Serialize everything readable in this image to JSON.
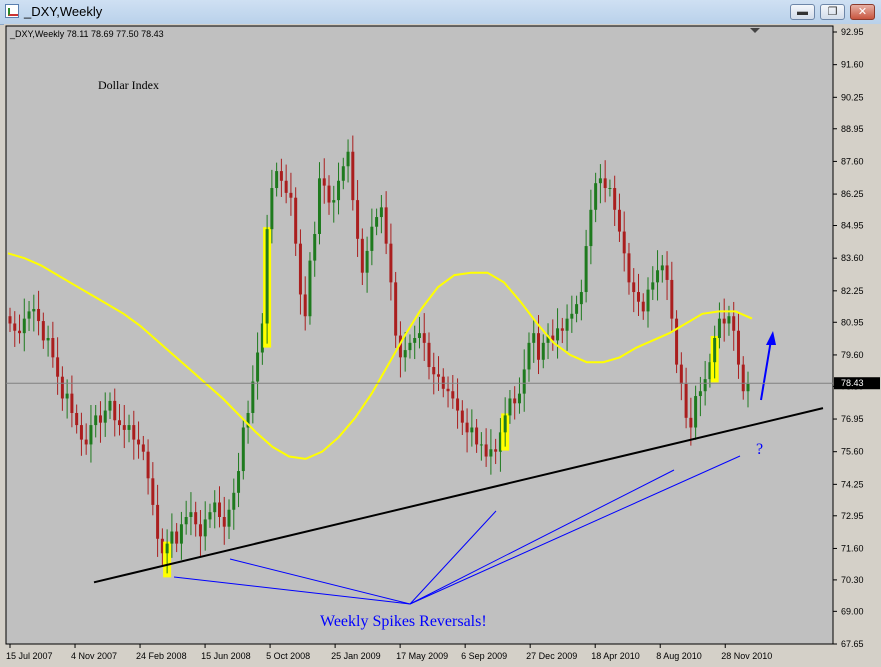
{
  "window": {
    "title": "_DXY,Weekly",
    "buttons": {
      "minimize": "▬",
      "restore": "❐",
      "close": "✕"
    }
  },
  "chart_header": {
    "symbol_line": "_DXY,Weekly  78.11 78.69 77.50 78.43",
    "title": "Dollar Index"
  },
  "chart_data": {
    "type": "candlestick",
    "symbol": "_DXY",
    "timeframe": "Weekly",
    "ohlc_last": {
      "open": 78.11,
      "high": 78.69,
      "low": 77.5,
      "close": 78.43
    },
    "current_price_label": "78.43",
    "ylim": [
      67.65,
      92.95
    ],
    "y_ticks": [
      "92.95",
      "91.60",
      "90.25",
      "88.95",
      "87.60",
      "86.25",
      "84.95",
      "83.60",
      "82.25",
      "80.95",
      "79.60",
      "78.30",
      "76.95",
      "75.60",
      "74.25",
      "72.95",
      "71.60",
      "70.30",
      "69.00",
      "67.65"
    ],
    "x_ticks": [
      "15 Jul 2007",
      "4 Nov 2007",
      "24 Feb 2008",
      "15 Jun 2008",
      "5 Oct 2008",
      "25 Jan 2009",
      "17 May 2009",
      "6 Sep 2009",
      "27 Dec 2009",
      "18 Apr 2010",
      "8 Aug 2010",
      "28 Nov 2010"
    ],
    "closes": [
      80.9,
      80.6,
      80.5,
      81.1,
      81.4,
      81.5,
      81.0,
      80.2,
      80.3,
      79.5,
      78.7,
      77.8,
      78.0,
      77.2,
      76.7,
      76.1,
      75.9,
      76.7,
      77.1,
      76.8,
      77.3,
      77.7,
      76.9,
      76.7,
      76.5,
      76.7,
      76.1,
      75.9,
      75.6,
      74.5,
      73.4,
      72.0,
      71.4,
      71.8,
      72.3,
      71.8,
      72.6,
      72.9,
      73.1,
      72.6,
      72.1,
      72.8,
      73.1,
      73.5,
      72.9,
      72.5,
      73.2,
      73.9,
      74.8,
      76.6,
      77.2,
      78.5,
      79.7,
      80.9,
      84.8,
      86.5,
      87.2,
      86.8,
      86.3,
      86.1,
      84.2,
      82.1,
      81.2,
      83.5,
      84.6,
      86.9,
      86.6,
      85.9,
      86.0,
      86.8,
      87.4,
      88.0,
      86.0,
      84.4,
      83.0,
      83.9,
      84.9,
      85.3,
      85.7,
      84.2,
      82.6,
      80.4,
      79.5,
      79.8,
      80.1,
      80.3,
      80.5,
      80.1,
      79.1,
      78.8,
      78.7,
      78.2,
      78.1,
      77.8,
      77.3,
      76.8,
      76.4,
      76.6,
      75.9,
      75.9,
      75.4,
      75.7,
      75.6,
      76.4,
      77.1,
      77.8,
      77.6,
      78.0,
      79.0,
      80.1,
      80.5,
      79.4,
      80.1,
      80.4,
      80.2,
      80.7,
      80.6,
      81.1,
      81.3,
      81.7,
      82.2,
      84.1,
      85.6,
      86.7,
      86.9,
      86.5,
      86.5,
      85.6,
      84.7,
      83.8,
      82.6,
      82.2,
      81.8,
      81.4,
      82.3,
      82.6,
      83.1,
      83.3,
      82.7,
      81.1,
      79.2,
      78.4,
      77.0,
      76.6,
      77.9,
      78.1,
      78.6,
      79.3,
      80.3,
      81.1,
      80.9,
      81.2,
      80.6,
      79.2,
      78.1,
      78.4
    ],
    "moving_average": {
      "color": "#ffff00",
      "values": [
        83.8,
        83.6,
        83.3,
        82.9,
        82.5,
        82.1,
        81.7,
        81.3,
        80.8,
        80.2,
        79.6,
        79.0,
        78.4,
        77.8,
        77.1,
        76.4,
        75.8,
        75.4,
        75.3,
        75.6,
        76.2,
        77.0,
        78.0,
        79.2,
        80.4,
        81.5,
        82.4,
        82.9,
        83.0,
        83.0,
        82.6,
        81.8,
        80.9,
        80.1,
        79.6,
        79.3,
        79.3,
        79.5,
        79.9,
        80.2,
        80.5,
        80.9,
        81.3,
        81.4,
        81.4,
        81.1
      ]
    },
    "trendline": {
      "color": "#000000"
    },
    "annotations": [
      {
        "text": "Weekly Spikes Reversals!",
        "color": "#0000ff"
      },
      {
        "text": "?",
        "color": "#0000ff"
      }
    ]
  },
  "colors": {
    "background": "#c0c0c0",
    "bull_candle": "#1e7a1e",
    "bear_candle": "#aa1e1e",
    "spike_highlight": "#ffff00",
    "annotation_blue": "#0000ff"
  }
}
